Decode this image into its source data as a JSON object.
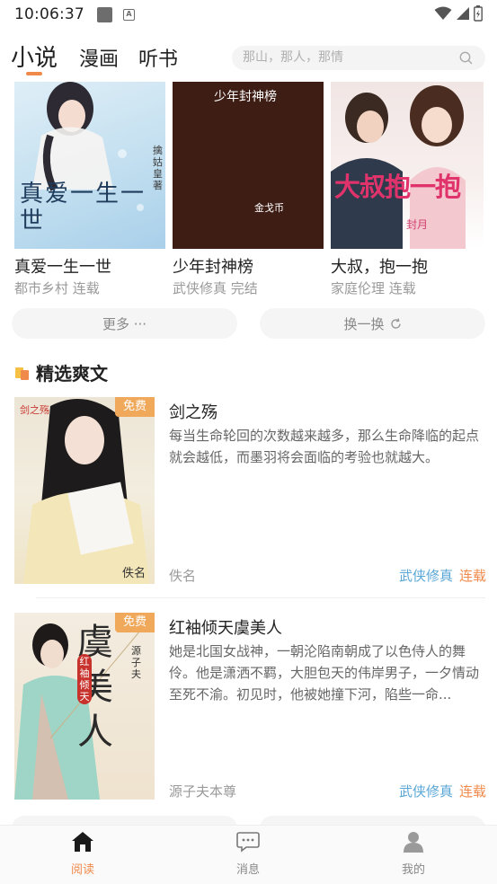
{
  "status_bar": {
    "time": "10:06:37",
    "status_glyph": "A"
  },
  "top_tabs": [
    {
      "label": "小说"
    },
    {
      "label": "漫画"
    },
    {
      "label": "听书"
    }
  ],
  "search": {
    "placeholder": "那山，那人，那情"
  },
  "featured_books": [
    {
      "title": "真爱一生一世",
      "meta": "都市乡村 连载",
      "cover_text": "真爱一生一世",
      "cover_author": "擒姑皇 著"
    },
    {
      "title": "少年封神榜",
      "meta": "武侠修真 完结",
      "cover_text": "少年封神榜",
      "cover_author": "金戈币"
    },
    {
      "title": "大叔，抱一抱",
      "meta": "家庭伦理 连载",
      "cover_text": "大叔抱一抱",
      "cover_author": "封月"
    }
  ],
  "actions": {
    "more_label": "更多 ···",
    "refresh_label": "换一换"
  },
  "section": {
    "title": "精选爽文"
  },
  "list": [
    {
      "title": "剑之殇",
      "badge": "免费",
      "desc": "每当生命轮回的次数越来越多，那么生命降临的起点就会越低，而墨羽将会面临的考验也就越大。",
      "author": "佚名",
      "category": "武侠修真",
      "status": "连载",
      "cover_text_top": "剑之殇",
      "cover_text_bottom": "佚名"
    },
    {
      "title": "红袖倾天虞美人",
      "badge": "免费",
      "desc": "她是北国女战神，一朝沦陷南朝成了以色侍人的舞伶。他是潇洒不羁，大胆包天的伟岸男子，一夕情动至死不渝。初见时，他被她撞下河，陷些一命...",
      "author": "源子夫本尊",
      "category": "武侠修真",
      "status": "连载",
      "cover_text_big": "虞美人",
      "cover_text_small": "红袖倾天",
      "cover_author": "源子夫"
    }
  ],
  "bottom_nav": [
    {
      "label": "阅读",
      "icon": "home-icon",
      "active": true
    },
    {
      "label": "消息",
      "icon": "message-icon",
      "active": false
    },
    {
      "label": "我的",
      "icon": "user-icon",
      "active": false
    }
  ],
  "colors": {
    "accent": "#f08a4b",
    "category": "#5aa6d6",
    "badge": "#f0a85b"
  }
}
